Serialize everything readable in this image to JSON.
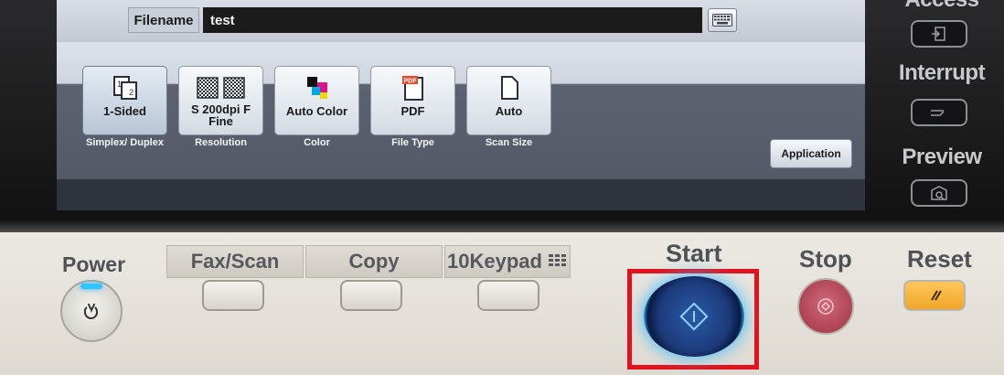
{
  "screen": {
    "filename_label": "Filename",
    "filename_value": "test",
    "keyboard_icon": "keyboard-icon",
    "tiles": [
      {
        "value": "1-Sided",
        "caption": "Simplex/ Duplex",
        "icon": "simplex-duplex-icon"
      },
      {
        "value": "S 200dpi F Fine",
        "caption": "Resolution",
        "icon": "resolution-icon"
      },
      {
        "value": "Auto Color",
        "caption": "Color",
        "icon": "color-icon"
      },
      {
        "value": "PDF",
        "caption": "File Type",
        "icon": "pdf-icon",
        "icon_text": "PDF"
      },
      {
        "value": "Auto",
        "caption": "Scan Size",
        "icon": "page-icon"
      }
    ],
    "application_label": "Application"
  },
  "side_keys": {
    "access_label": "Access",
    "interrupt_label": "Interrupt",
    "preview_label": "Preview"
  },
  "panel": {
    "power_label": "Power",
    "fax_scan_label": "Fax/Scan",
    "copy_label": "Copy",
    "keypad_label": "10Keypad",
    "start_label": "Start",
    "stop_label": "Stop",
    "reset_label": "Reset"
  },
  "colors": {
    "start_glow": "#2fb8ff",
    "highlight_box": "#e3111b",
    "stop_key": "#b13b4d",
    "reset_key": "#f4b03a",
    "power_led": "#31c4ff"
  }
}
